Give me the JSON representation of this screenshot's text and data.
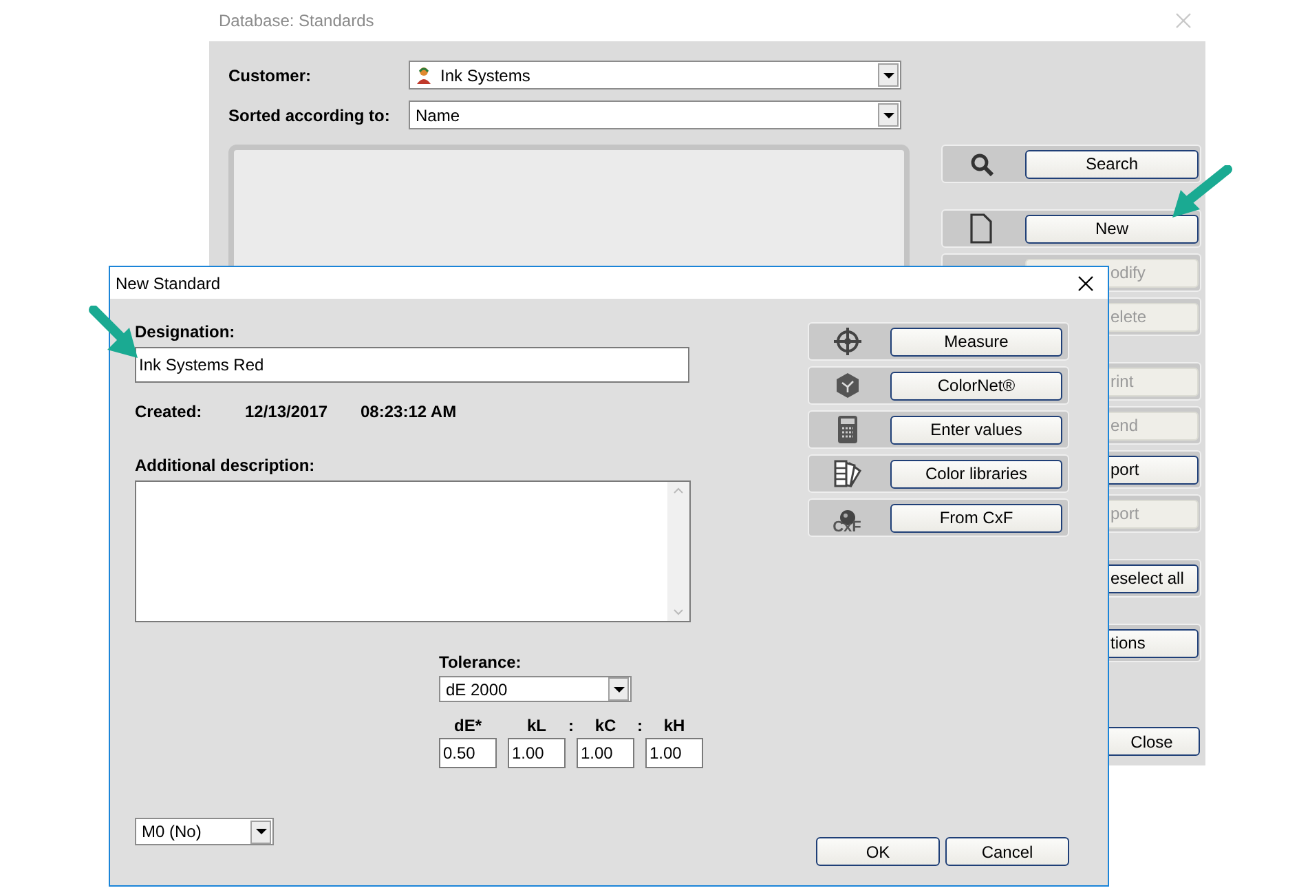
{
  "back_window": {
    "title": "Database: Standards",
    "fields": [
      {
        "label": "Customer:",
        "value": "Ink Systems",
        "kind": "customer"
      },
      {
        "label": "Sorted according to:",
        "value": "Name",
        "kind": "plain"
      }
    ],
    "action_groups": [
      [
        {
          "label": "Search",
          "kind": "search",
          "disabled": false,
          "partial": false
        }
      ],
      [
        {
          "label": "New",
          "kind": "new",
          "disabled": false,
          "partial": false
        },
        {
          "label": "odify",
          "kind": "none",
          "disabled": true,
          "partial": true
        },
        {
          "label": "elete",
          "kind": "none",
          "disabled": true,
          "partial": true
        }
      ],
      [
        {
          "label": "rint",
          "kind": "none",
          "disabled": true,
          "partial": true
        },
        {
          "label": "end",
          "kind": "none",
          "disabled": true,
          "partial": true
        },
        {
          "label": "port",
          "kind": "none",
          "disabled": false,
          "partial": true
        },
        {
          "label": "port",
          "kind": "none",
          "disabled": true,
          "partial": true
        }
      ],
      [
        {
          "label": "eselect all",
          "kind": "none",
          "disabled": false,
          "partial": true
        }
      ],
      [
        {
          "label": "tions",
          "kind": "none",
          "disabled": false,
          "partial": true
        }
      ]
    ],
    "close_button": "Close"
  },
  "dialog": {
    "title": "New Standard",
    "designation": {
      "label": "Designation:",
      "value": "Ink Systems Red"
    },
    "created": {
      "label": "Created:",
      "date": "12/13/2017",
      "time": "08:23:12 AM"
    },
    "description": {
      "label": "Additional description:"
    },
    "tolerance": {
      "label": "Tolerance:",
      "value": "dE 2000",
      "params": [
        {
          "label": "dE*",
          "value": "0.50"
        },
        {
          "label": "kL",
          "value": "1.00",
          "separator": ":"
        },
        {
          "label": "kC",
          "value": "1.00",
          "separator": ":"
        },
        {
          "label": "kH",
          "value": "1.00"
        }
      ]
    },
    "mode_select": "M0 (No)",
    "sources": [
      {
        "label": "Measure",
        "kind": "measure"
      },
      {
        "label": "ColorNet®",
        "kind": "colornet"
      },
      {
        "label": "Enter values",
        "kind": "calculator"
      },
      {
        "label": "Color libraries",
        "kind": "library"
      },
      {
        "label": "From CxF",
        "kind": "cxf",
        "icon_text": "CxF"
      }
    ],
    "buttons": [
      "OK",
      "Cancel"
    ]
  }
}
